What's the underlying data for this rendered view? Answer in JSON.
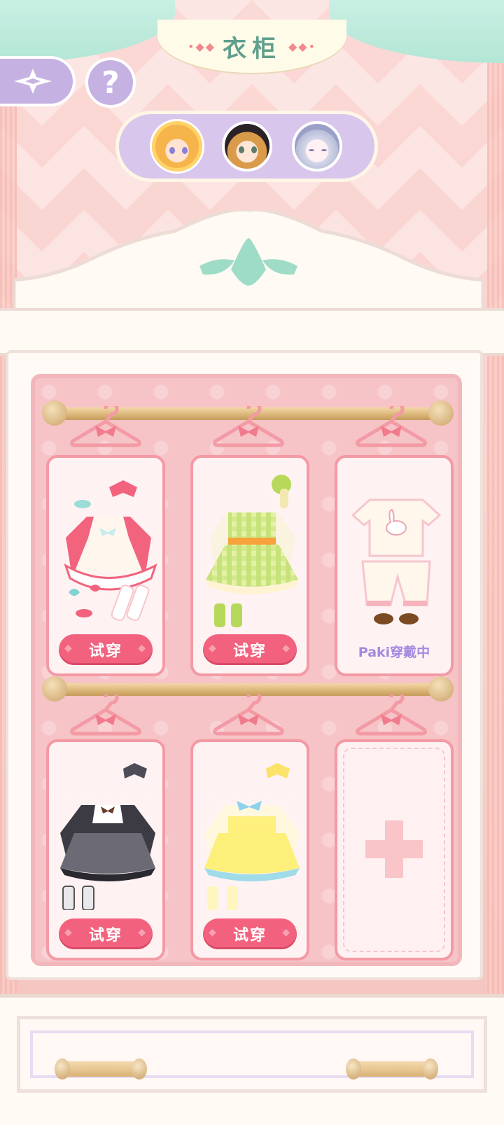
{
  "header": {
    "title": "衣柜",
    "back_icon": "back-sparkle-icon",
    "help_label": "?"
  },
  "characters": [
    {
      "name": "character-blonde-girl",
      "selected": true
    },
    {
      "name": "character-brown-hair-boy",
      "selected": false
    },
    {
      "name": "character-silver-hair-girl",
      "selected": false
    }
  ],
  "wardrobe": {
    "slots": [
      {
        "outfit": "pink-white-dress-outfit",
        "action_label": "试穿"
      },
      {
        "outfit": "green-gingham-dress-outfit",
        "action_label": "试穿"
      },
      {
        "outfit": "cream-bunny-pajama-outfit",
        "status_label": "Paki穿戴中"
      },
      {
        "outfit": "black-gothic-dress-outfit",
        "action_label": "试穿"
      },
      {
        "outfit": "yellow-dress-outfit",
        "action_label": "试穿"
      },
      {
        "outfit": "empty",
        "add_icon": "plus-icon"
      }
    ]
  },
  "colors": {
    "accent_pink": "#f2627e",
    "title_green": "#5f9f8c",
    "lavender": "#c6b1e3",
    "wearing_text": "#a48ae0"
  }
}
